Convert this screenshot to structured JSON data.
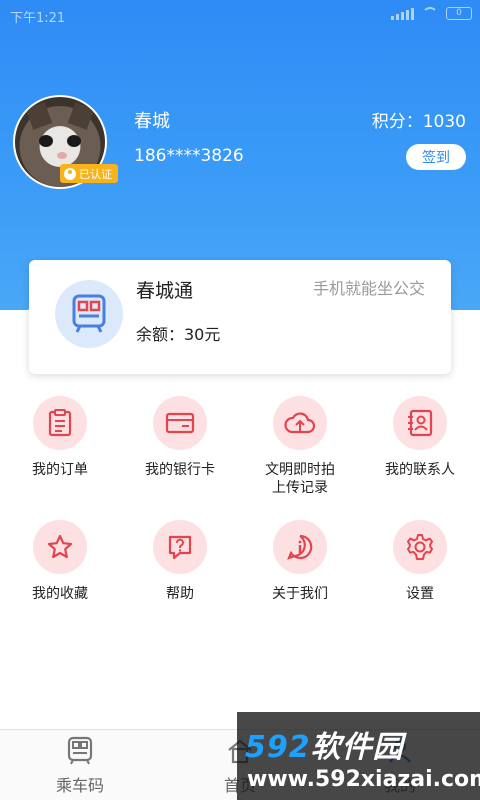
{
  "status_bar": {
    "time": "下午1:21",
    "battery": "0"
  },
  "profile": {
    "username": "春城",
    "phone": "186****3826",
    "points": "积分：1030",
    "verified_badge": "已认证",
    "signin_label": "签到"
  },
  "card": {
    "title": "春城通",
    "slogan": "手机就能坐公交",
    "balance": "余额：30元"
  },
  "menu": [
    {
      "label": "我的订单",
      "icon": "clipboard-icon"
    },
    {
      "label": "我的银行卡",
      "icon": "bank-card-icon"
    },
    {
      "label": "文明即时拍\n上传记录",
      "icon": "cloud-upload-icon"
    },
    {
      "label": "我的联系人",
      "icon": "contacts-icon"
    },
    {
      "label": "我的收藏",
      "icon": "star-icon"
    },
    {
      "label": "帮助",
      "icon": "help-icon"
    },
    {
      "label": "关于我们",
      "icon": "info-icon"
    },
    {
      "label": "设置",
      "icon": "gear-icon"
    }
  ],
  "bottom_nav": [
    {
      "label": "乘车码",
      "icon": "bus-qr-icon"
    },
    {
      "label": "首页",
      "icon": "home-icon"
    },
    {
      "label": "我的",
      "icon": "user-icon"
    }
  ],
  "watermark": {
    "brand_num": "592",
    "brand_cn": "软件园",
    "url": "www.592xiazai.com"
  },
  "colors": {
    "accent": "#2f8bf5",
    "icon_red": "#e2454f",
    "icon_bg": "#fde0e2",
    "badge": "#f6b31b"
  }
}
